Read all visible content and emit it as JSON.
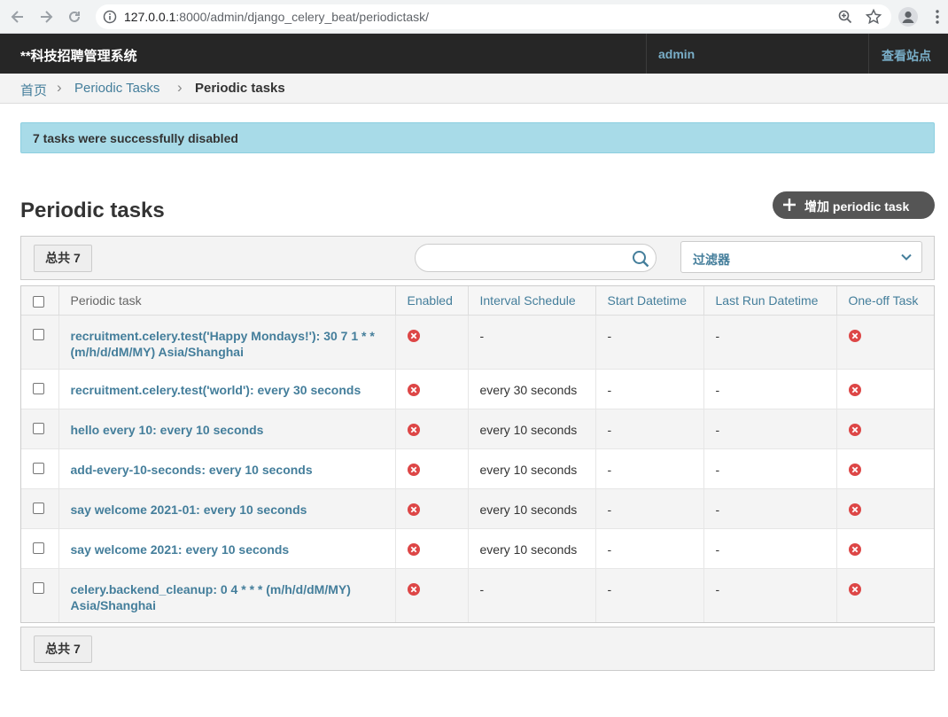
{
  "browser": {
    "url_host": "127.0.0.1",
    "url_rest": ":8000/admin/django_celery_beat/periodictask/"
  },
  "header": {
    "site_title": "**科技招聘管理系统",
    "user": "admin",
    "view_site": "查看站点"
  },
  "breadcrumbs": {
    "home": "首页",
    "sep": "›",
    "app": "Periodic Tasks",
    "current": "Periodic tasks"
  },
  "message": "7 tasks were successfully disabled",
  "page_title": "Periodic tasks",
  "add_button": "增加 periodic task",
  "toolbar": {
    "count": "总共 7",
    "search_placeholder": "",
    "filter_label": "过滤器"
  },
  "table": {
    "headers": [
      "Periodic task",
      "Enabled",
      "Interval Schedule",
      "Start Datetime",
      "Last Run Datetime",
      "One-off Task"
    ],
    "rows": [
      {
        "task": "recruitment.celery.test('Happy Mondays!'): 30 7 1 * * (m/h/d/dM/MY) Asia/Shanghai",
        "enabled": false,
        "interval": "-",
        "start": "-",
        "last_run": "-",
        "one_off": false
      },
      {
        "task": "recruitment.celery.test('world'): every 30 seconds",
        "enabled": false,
        "interval": "every 30 seconds",
        "start": "-",
        "last_run": "-",
        "one_off": false
      },
      {
        "task": "hello every 10: every 10 seconds",
        "enabled": false,
        "interval": "every 10 seconds",
        "start": "-",
        "last_run": "-",
        "one_off": false
      },
      {
        "task": "add-every-10-seconds: every 10 seconds",
        "enabled": false,
        "interval": "every 10 seconds",
        "start": "-",
        "last_run": "-",
        "one_off": false
      },
      {
        "task": "say welcome 2021-01: every 10 seconds",
        "enabled": false,
        "interval": "every 10 seconds",
        "start": "-",
        "last_run": "-",
        "one_off": false
      },
      {
        "task": "say welcome 2021: every 10 seconds",
        "enabled": false,
        "interval": "every 10 seconds",
        "start": "-",
        "last_run": "-",
        "one_off": false
      },
      {
        "task": "celery.backend_cleanup: 0 4 * * * (m/h/d/dM/MY) Asia/Shanghai",
        "enabled": false,
        "interval": "-",
        "start": "-",
        "last_run": "-",
        "one_off": false
      }
    ]
  },
  "paginator": {
    "count": "总共 7"
  },
  "colors": {
    "link": "#447e9b",
    "header_bg": "#262626",
    "message_bg": "#a8dbe8",
    "no_icon": "#dd4646"
  }
}
